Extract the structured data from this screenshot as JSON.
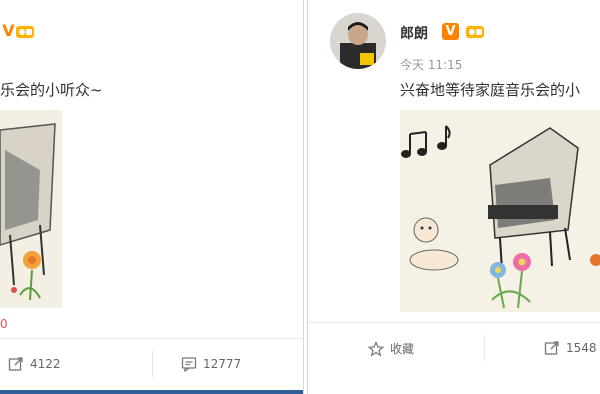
{
  "left_post": {
    "text": "乐会的小听众~",
    "repost_count": "4122",
    "comment_count": "12777",
    "small_count": "0"
  },
  "right_post": {
    "author": "郎朗",
    "time": "今天 11:15",
    "text": "兴奋地等待家庭音乐会的小",
    "favorite_label": "收藏",
    "repost_count": "1548"
  },
  "colors": {
    "verified_orange": "#ff8200",
    "bottom_strip_blue": "#2f5e98",
    "gray_text": "#999999"
  }
}
